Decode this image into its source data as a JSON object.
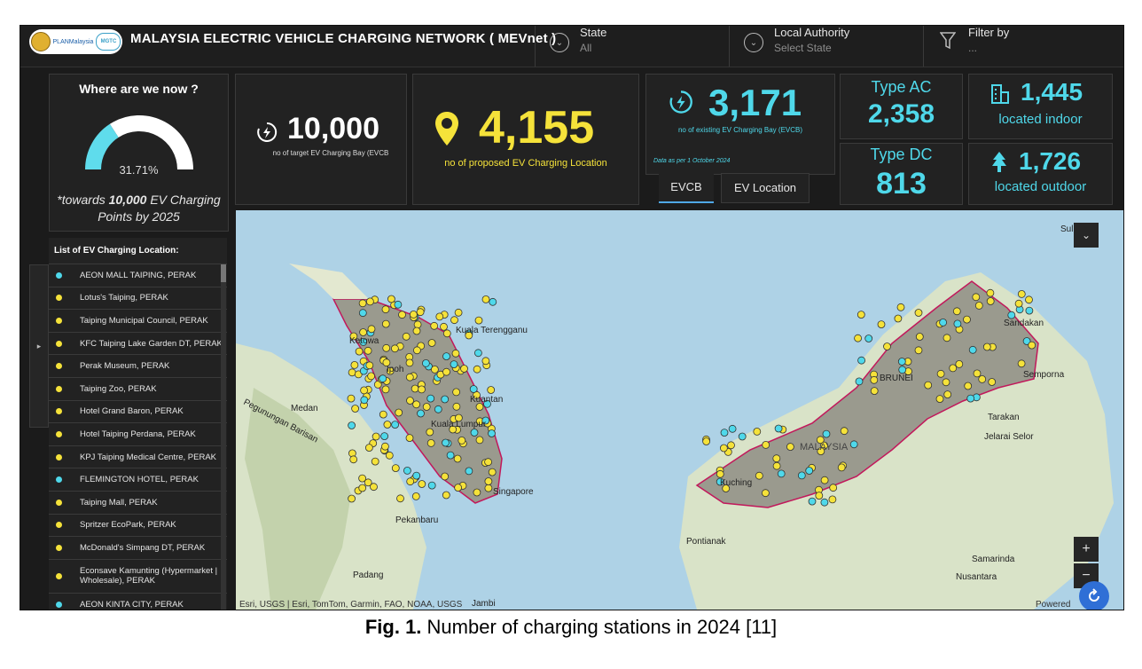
{
  "header": {
    "logo_text_1": "PLANMalaysia",
    "logo_text_2": "MGTC",
    "title": "MALAYSIA ELECTRIC VEHICLE CHARGING NETWORK ( MEVnet )",
    "filters": [
      {
        "label": "State",
        "value": "All",
        "icon": "chevron-down-circle-icon"
      },
      {
        "label": "Local Authority",
        "value": "Select State",
        "icon": "chevron-down-circle-icon"
      },
      {
        "label": "Filter by",
        "value": "...",
        "icon": "funnel-icon"
      }
    ]
  },
  "gauge": {
    "title": "Where are we now ?",
    "percent_text": "31.71%",
    "percent_value": 31.71,
    "note_prefix": "*towards ",
    "note_bold": "10,000",
    "note_suffix": " EV Charging Points by 2025",
    "colors": {
      "fill": "#5fdcec",
      "track": "#ffffff"
    }
  },
  "kpis": {
    "target": {
      "value": "10,000",
      "label": "no of target EV Charging Bay (EVCB",
      "icon": "charging-bolt-icon"
    },
    "proposed": {
      "value": "4,155",
      "label": "no of proposed EV Charging Location",
      "icon": "location-pin-icon"
    },
    "existing": {
      "value": "3,171",
      "label": "no of existing EV Charging Bay (EVCB)",
      "note": "Data as per 1 October 2024",
      "icon": "charging-bolt-icon"
    },
    "type_ac": {
      "label": "Type AC",
      "value": "2,358"
    },
    "type_dc": {
      "label": "Type DC",
      "value": "813"
    },
    "indoor": {
      "value": "1,445",
      "label": "located indoor",
      "icon": "building-icon"
    },
    "outdoor": {
      "value": "1,726",
      "label": "located outdoor",
      "icon": "tree-icon"
    }
  },
  "tabs": [
    {
      "label": "EVCB",
      "active": true
    },
    {
      "label": "EV Location",
      "active": false
    }
  ],
  "location_list": {
    "heading": "List of EV Charging Location:",
    "items": [
      {
        "name": "AEON MALL TAIPING, PERAK",
        "color": "#4fd8ea"
      },
      {
        "name": "Lotus's Taiping, PERAK",
        "color": "#f5e23a"
      },
      {
        "name": "Taiping Municipal Council, PERAK",
        "color": "#f5e23a"
      },
      {
        "name": "KFC Taiping Lake Garden DT, PERAK",
        "color": "#f5e23a"
      },
      {
        "name": "Perak Museum, PERAK",
        "color": "#f5e23a"
      },
      {
        "name": "Taiping Zoo, PERAK",
        "color": "#f5e23a"
      },
      {
        "name": "Hotel Grand Baron, PERAK",
        "color": "#f5e23a"
      },
      {
        "name": "Hotel Taiping Perdana, PERAK",
        "color": "#f5e23a"
      },
      {
        "name": "KPJ Taiping Medical Centre, PERAK",
        "color": "#f5e23a"
      },
      {
        "name": "FLEMINGTON HOTEL, PERAK",
        "color": "#4fd8ea"
      },
      {
        "name": "Taiping Mall, PERAK",
        "color": "#f5e23a"
      },
      {
        "name": "Spritzer EcoPark, PERAK",
        "color": "#f5e23a"
      },
      {
        "name": "McDonald's Simpang DT, PERAK",
        "color": "#f5e23a"
      },
      {
        "name": "Econsave Kamunting (Hypermarket | Wholesale), PERAK",
        "color": "#f5e23a"
      },
      {
        "name": "AEON KINTA CITY, PERAK",
        "color": "#4fd8ea"
      }
    ]
  },
  "map": {
    "places": [
      "Kuala Terengganu",
      "Medan",
      "Kuantan",
      "Pekanbaru",
      "Padang",
      "Singapore",
      "Sandakan",
      "Semporna",
      "Tarakan",
      "Jelarai Selor",
      "Kuching",
      "Pontianak",
      "Samarinda",
      "Nusantara",
      "MALAYSIA",
      "BRUNEI",
      "Pegunungan Barisan",
      "Jambi",
      "Sulu",
      "Ipoh",
      "Kuala Lumpur",
      "Ketowa"
    ],
    "attribution": "Esri, USGS | Esri, TomTom, Garmin, FAO, NOAA, USGS",
    "powered_by": "Powered",
    "zoom_in": "+",
    "zoom_out": "−",
    "collapse_icon": "chevrons-down-icon",
    "refresh_icon": "refresh-icon"
  },
  "caption": {
    "label": "Fig. 1.",
    "text": " Number of charging stations in 2024 [11]"
  }
}
